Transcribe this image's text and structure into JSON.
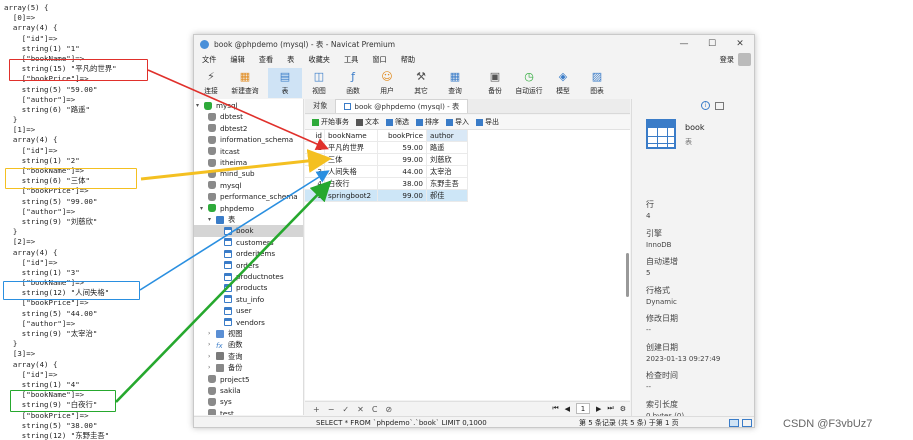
{
  "dump_lines": [
    "array(5) {",
    "  [0]=>",
    "  array(4) {",
    "    [\"id\"]=>",
    "    string(1) \"1\"",
    "    [\"bookName\"]=>",
    "    string(15) \"平凡的世界\"",
    "    [\"bookPrice\"]=>",
    "    string(5) \"59.00\"",
    "    [\"author\"]=>",
    "    string(6) \"路遥\"",
    "  }",
    "  [1]=>",
    "  array(4) {",
    "    [\"id\"]=>",
    "    string(1) \"2\"",
    "    [\"bookName\"]=>",
    "    string(6) \"三体\"",
    "    [\"bookPrice\"]=>",
    "    string(5) \"99.00\"",
    "    [\"author\"]=>",
    "    string(9) \"刘慈欣\"",
    "  }",
    "  [2]=>",
    "  array(4) {",
    "    [\"id\"]=>",
    "    string(1) \"3\"",
    "    [\"bookName\"]=>",
    "    string(12) \"人间失格\"",
    "    [\"bookPrice\"]=>",
    "    string(5) \"44.00\"",
    "    [\"author\"]=>",
    "    string(9) \"太宰治\"",
    "  }",
    "  [3]=>",
    "  array(4) {",
    "    [\"id\"]=>",
    "    string(1) \"4\"",
    "    [\"bookName\"]=>",
    "    string(9) \"白夜行\"",
    "    [\"bookPrice\"]=>",
    "    string(5) \"38.00\"",
    "    string(12) \"东野圭吾\""
  ],
  "highlight_colors": [
    "#e0302b",
    "#f4c021",
    "#2a8fe0",
    "#26a82e"
  ],
  "window": {
    "title": "book @phpdemo (mysql) - 表 - Navicat Premium",
    "controls": [
      "—",
      "☐",
      "✕"
    ]
  },
  "menu": [
    "文件",
    "编辑",
    "查看",
    "表",
    "收藏夹",
    "工具",
    "窗口",
    "帮助"
  ],
  "login_label": "登录",
  "toolbar": [
    {
      "label": "连接",
      "icon": "plug-icon"
    },
    {
      "label": "新建查询",
      "icon": "new-query-icon"
    },
    {
      "label": "表",
      "icon": "table-icon",
      "active": true
    },
    {
      "label": "视图",
      "icon": "view-icon"
    },
    {
      "label": "函数",
      "icon": "function-icon"
    },
    {
      "label": "用户",
      "icon": "user-icon"
    },
    {
      "label": "其它",
      "icon": "tools-icon"
    },
    {
      "label": "查询",
      "icon": "query-icon"
    },
    {
      "label": "备份",
      "icon": "backup-icon"
    },
    {
      "label": "自动运行",
      "icon": "schedule-icon"
    },
    {
      "label": "模型",
      "icon": "model-icon"
    },
    {
      "label": "图表",
      "icon": "chart-icon"
    }
  ],
  "tree": {
    "connection": "mysql",
    "databases": [
      "dbtest",
      "dbtest2",
      "information_schema",
      "itcast",
      "itheima",
      "mind_sub",
      "mysql",
      "performance_schema"
    ],
    "open_db": "phpdemo",
    "tables_label": "表",
    "tables": [
      "book",
      "customers",
      "orderitems",
      "orders",
      "productnotes",
      "products",
      "stu_info",
      "user",
      "vendors"
    ],
    "sub_nodes": [
      "视图",
      "函数",
      "查询",
      "备份"
    ],
    "after_dbs": [
      "project5",
      "sakila",
      "sys",
      "test"
    ]
  },
  "tabs": [
    "对象",
    "book @phpdemo (mysql) - 表"
  ],
  "subtoolbar": [
    "开始事务",
    "文本",
    "筛选",
    "排序",
    "导入",
    "导出"
  ],
  "grid": {
    "columns": [
      "id",
      "bookName",
      "bookPrice",
      "author"
    ],
    "rows": [
      [
        "1",
        "平凡的世界",
        "59.00",
        "路遥"
      ],
      [
        "2",
        "三体",
        "99.00",
        "刘慈欣"
      ],
      [
        "3",
        "人间失格",
        "44.00",
        "太宰治"
      ],
      [
        "4",
        "白夜行",
        "38.00",
        "东野圭吾"
      ],
      [
        "5",
        "springboot2",
        "99.00",
        "郝佳"
      ]
    ]
  },
  "bottom_buttons": [
    "+",
    "−",
    "✓",
    "✕",
    "C",
    "⊘"
  ],
  "pager": {
    "first": "⏮",
    "prev": "◀",
    "page": "1",
    "next": "▶",
    "last": "⏭",
    "settings": "⚙"
  },
  "info": {
    "table_name": "book",
    "table_sub": "表",
    "fields": [
      {
        "key": "行",
        "value": "4"
      },
      {
        "key": "引擎",
        "value": "InnoDB"
      },
      {
        "key": "自动递增",
        "value": "5"
      },
      {
        "key": "行格式",
        "value": "Dynamic"
      },
      {
        "key": "修改日期",
        "value": "--"
      },
      {
        "key": "创建日期",
        "value": "2023-01-13 09:27:49"
      },
      {
        "key": "检查时间",
        "value": "--"
      },
      {
        "key": "索引长度",
        "value": "0 bytes (0)"
      },
      {
        "key": "数据长度",
        "value": "16.00 KB (16,384)"
      }
    ]
  },
  "status": {
    "sql": "SELECT * FROM `phpdemo`.`book` LIMIT 0,1000",
    "records": "第 5 条记录 (共 5 条) 于第 1 页"
  },
  "watermark": "CSDN @F3vbUz7"
}
